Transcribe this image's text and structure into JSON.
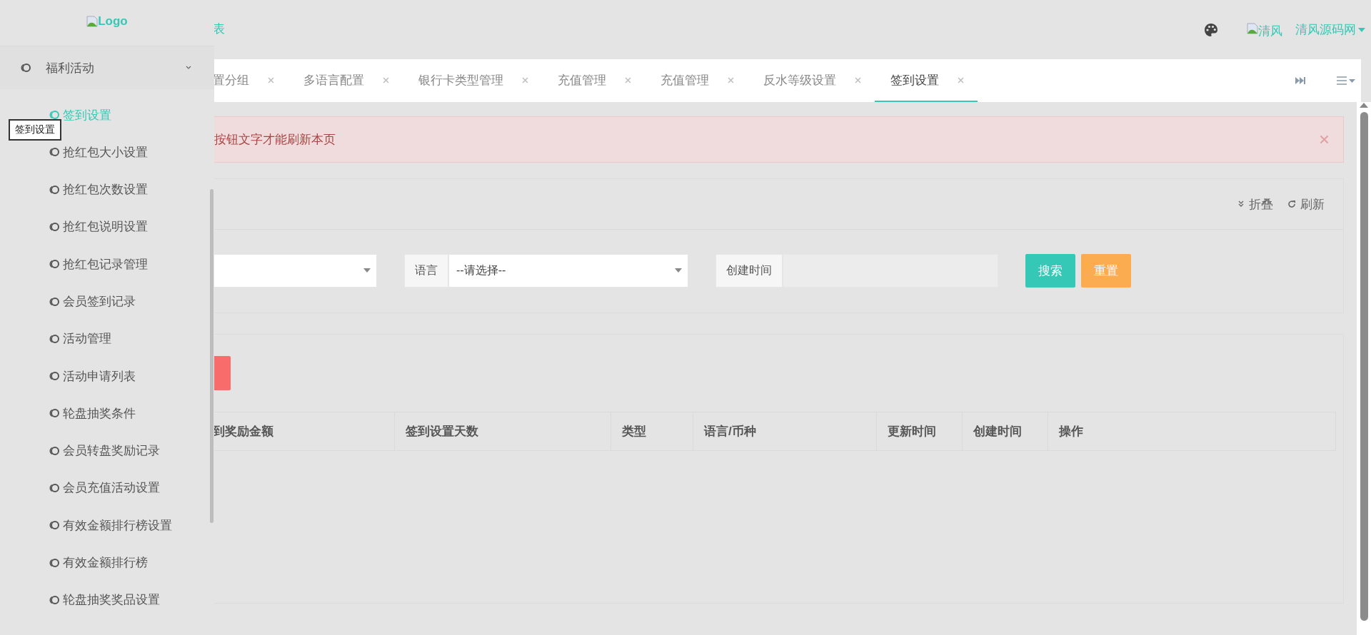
{
  "sidebar": {
    "logo_alt": "Logo",
    "menu": {
      "label": "福利活动",
      "expanded": true,
      "children": [
        {
          "label": "签到设置",
          "selected": true
        },
        {
          "label": "抢红包大小设置",
          "selected": false
        },
        {
          "label": "抢红包次数设置",
          "selected": false
        },
        {
          "label": "抢红包说明设置",
          "selected": false
        },
        {
          "label": "抢红包记录管理",
          "selected": false
        },
        {
          "label": "会员签到记录",
          "selected": false
        },
        {
          "label": "活动管理",
          "selected": false
        },
        {
          "label": "活动申请列表",
          "selected": false
        },
        {
          "label": "轮盘抽奖条件",
          "selected": false
        },
        {
          "label": "会员转盘奖励记录",
          "selected": false
        },
        {
          "label": "会员充值活动设置",
          "selected": false
        },
        {
          "label": "有效金额排行榜设置",
          "selected": false
        },
        {
          "label": "有效金额排行榜",
          "selected": false
        },
        {
          "label": "轮盘抽奖奖品设置",
          "selected": false
        }
      ]
    },
    "tooltip": "签到设置"
  },
  "topbar": {
    "breadcrumb": "表",
    "avatar_alt": "清风",
    "user": "清风源码网"
  },
  "tabs": [
    {
      "label": "置分组",
      "selected": false
    },
    {
      "label": "多语言配置",
      "selected": false
    },
    {
      "label": "银行卡类型管理",
      "selected": false
    },
    {
      "label": "充值管理",
      "selected": false
    },
    {
      "label": "充值管理",
      "selected": false
    },
    {
      "label": "反水等级设置",
      "selected": false
    },
    {
      "label": "签到设置",
      "selected": true
    }
  ],
  "alert": {
    "text": "按钮文字才能刷新本页"
  },
  "search_panel": {
    "actions": [
      "折叠",
      "刷新"
    ],
    "fields": [
      {
        "kind": "select"
      },
      {
        "kind": "select",
        "label": "语言",
        "value": "--请选择--"
      },
      {
        "kind": "date",
        "label": "创建时间"
      }
    ],
    "buttons": [
      {
        "label": "搜索",
        "kind": "primary"
      },
      {
        "label": "重置",
        "kind": "warning"
      }
    ]
  },
  "table_panel": {
    "toolbar_buttons": [
      {
        "kind": "danger"
      }
    ],
    "columns": [
      "到奖励金额",
      "签到设置天数",
      "类型",
      "语言/币种",
      "更新时间",
      "创建时间",
      "操作"
    ]
  }
}
